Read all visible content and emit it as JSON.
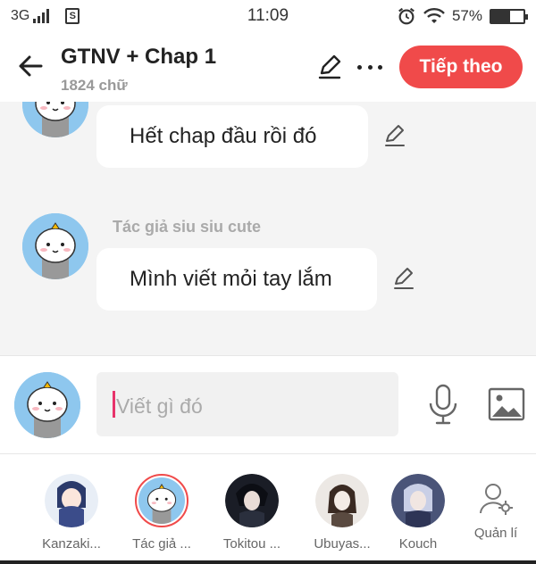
{
  "status_bar": {
    "network": "3G",
    "time": "11:09",
    "battery": "57%",
    "battery_level": 0.57
  },
  "header": {
    "title": "GTNV + Chap 1",
    "word_count": "1824 chữ",
    "next_label": "Tiếp theo"
  },
  "messages": [
    {
      "sender": "",
      "text": "Hết chap đầu rồi đó"
    },
    {
      "sender": "Tác giả siu siu cute",
      "text": "Mình viết mỏi tay lắm"
    }
  ],
  "composer": {
    "placeholder": "Viết gì đó"
  },
  "characters": [
    {
      "name": "Kanzaki...",
      "selected": false
    },
    {
      "name": "Tác giả ...",
      "selected": true
    },
    {
      "name": "Tokitou ...",
      "selected": false
    },
    {
      "name": "Ubuyas...",
      "selected": false
    },
    {
      "name": "Kouch",
      "selected": false
    }
  ],
  "manage_label": "Quản lí",
  "colors": {
    "accent": "#f04a4a",
    "caret": "#e8336b",
    "avatar_bg": "#8ec7ee"
  }
}
